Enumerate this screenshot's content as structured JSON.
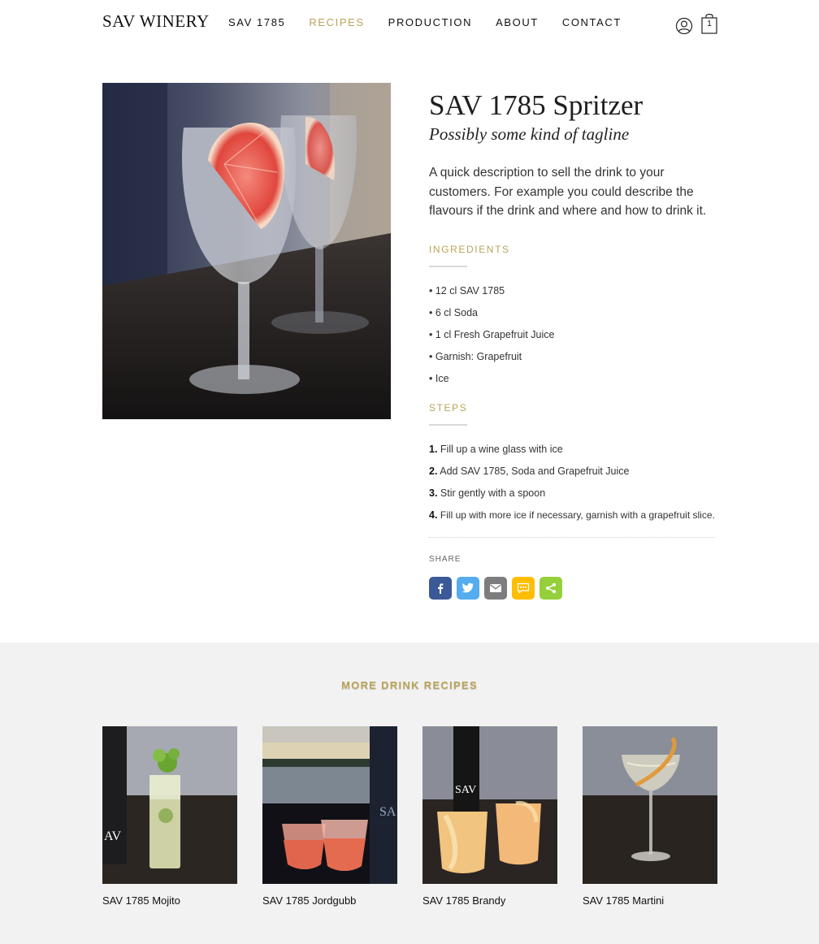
{
  "brand": {
    "logo": "SAV WINERY"
  },
  "nav": {
    "items": [
      {
        "label": "SAV 1785"
      },
      {
        "label": "RECIPES"
      },
      {
        "label": "PRODUCTION"
      },
      {
        "label": "ABOUT"
      },
      {
        "label": "CONTACT"
      }
    ],
    "active": "RECIPES",
    "cart_count": "1",
    "user_icon": "user-circle-icon",
    "cart_icon": "shopping-bag-icon"
  },
  "recipe": {
    "title": "SAV 1785 Spritzer",
    "tagline": "Possibly some kind of tagline",
    "description": "A quick description to sell the drink to your customers. For example you could describe the flavours if the drink and where and how to drink it.",
    "ingredients_title": "INGREDIENTS",
    "ingredients": [
      "12 cl SAV 1785",
      "6 cl Soda",
      "1 cl Fresh Grapefruit Juice",
      "Garnish: Grapefruit",
      "Ice"
    ],
    "steps_title": "STEPS",
    "steps": [
      {
        "num": "1.",
        "text": "Fill up a wine glass with ice"
      },
      {
        "num": "2.",
        "text": "Add SAV 1785, Soda and Grapefruit Juice"
      },
      {
        "num": "3.",
        "text": "Stir gently with a spoon"
      },
      {
        "num": "4.",
        "text": "Fill up with more ice if necessary, garnish with a grapefruit slice."
      }
    ]
  },
  "share": {
    "label": "SHARE",
    "buttons": [
      {
        "name": "facebook",
        "color": "#3b5998"
      },
      {
        "name": "twitter",
        "color": "#55acee"
      },
      {
        "name": "email",
        "color": "#7d7d7d"
      },
      {
        "name": "sms",
        "color": "#ffbd00"
      },
      {
        "name": "share",
        "color": "#95d03a"
      }
    ]
  },
  "more": {
    "title": "MORE DRINK RECIPES",
    "cards": [
      {
        "name": "SAV 1785 Mojito"
      },
      {
        "name": "SAV 1785 Jordgubb"
      },
      {
        "name": "SAV 1785 Brandy"
      },
      {
        "name": "SAV 1785 Martini"
      }
    ]
  },
  "colors": {
    "accent": "#b9a458",
    "section_bg": "#f2f2f2"
  }
}
